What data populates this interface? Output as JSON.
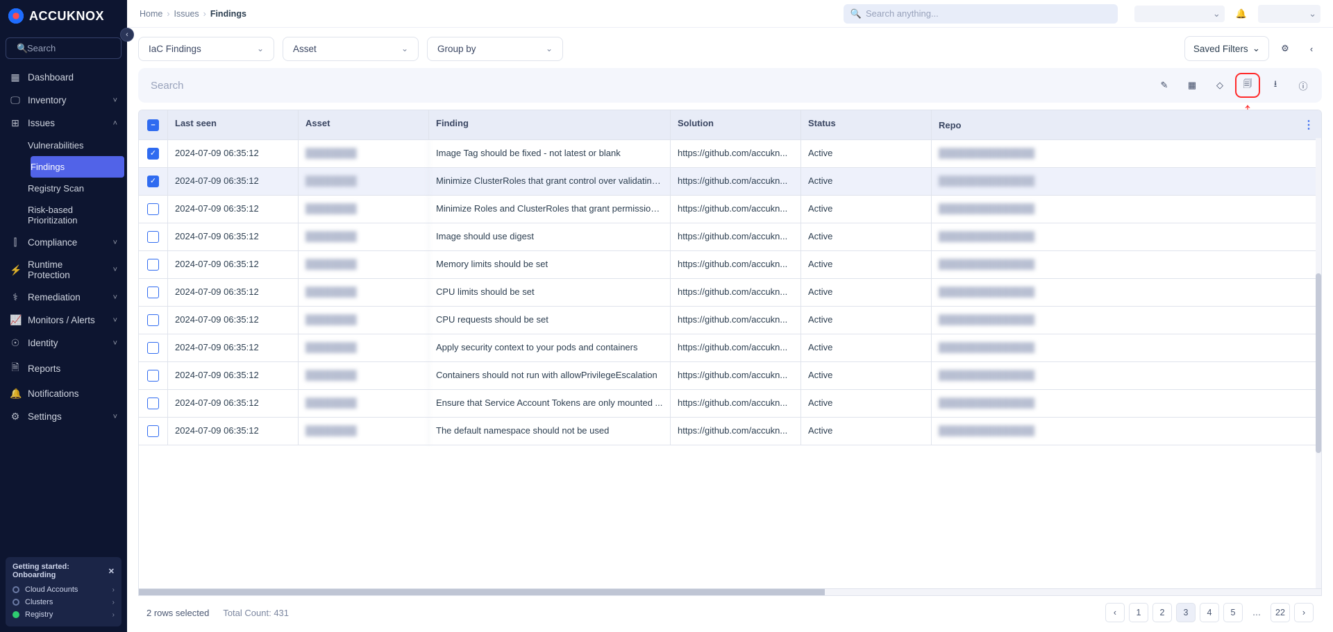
{
  "brand": {
    "name": "ACCUKNOX"
  },
  "sidebar": {
    "search_placeholder": "Search",
    "items": [
      {
        "label": "Dashboard",
        "icon": "▦",
        "expandable": false
      },
      {
        "label": "Inventory",
        "icon": "🖵",
        "expandable": true
      },
      {
        "label": "Issues",
        "icon": "⊞",
        "expandable": true,
        "expanded": true,
        "children": [
          {
            "label": "Vulnerabilities"
          },
          {
            "label": "Findings",
            "active": true
          },
          {
            "label": "Registry Scan"
          },
          {
            "label": "Risk-based Prioritization"
          }
        ]
      },
      {
        "label": "Compliance",
        "icon": "⫿",
        "expandable": true
      },
      {
        "label": "Runtime Protection",
        "icon": "⚡",
        "expandable": true
      },
      {
        "label": "Remediation",
        "icon": "⚕",
        "expandable": true
      },
      {
        "label": "Monitors / Alerts",
        "icon": "📈",
        "expandable": true
      },
      {
        "label": "Identity",
        "icon": "☉",
        "expandable": true
      },
      {
        "label": "Reports",
        "icon": "🗎",
        "expandable": false
      },
      {
        "label": "Notifications",
        "icon": "🔔",
        "expandable": false
      },
      {
        "label": "Settings",
        "icon": "⚙",
        "expandable": true
      }
    ],
    "onboarding": {
      "title": "Getting started: Onboarding",
      "items": [
        {
          "label": "Cloud Accounts",
          "done": false
        },
        {
          "label": "Clusters",
          "done": false
        },
        {
          "label": "Registry",
          "done": true
        }
      ]
    }
  },
  "breadcrumbs": [
    "Home",
    "Issues",
    "Findings"
  ],
  "global_search_placeholder": "Search anything...",
  "filters": {
    "type": "IaC Findings",
    "asset": "Asset",
    "groupby": "Group by",
    "saved": "Saved Filters"
  },
  "table_search_placeholder": "Search",
  "columns": [
    "",
    "Last seen",
    "Asset",
    "Finding",
    "Solution",
    "Status",
    "Repo"
  ],
  "rows": [
    {
      "checked": true,
      "last_seen": "2024-07-09 06:35:12",
      "finding": "Image Tag should be fixed - not latest or blank",
      "solution": "https://github.com/accukn...",
      "status": "Active"
    },
    {
      "checked": true,
      "last_seen": "2024-07-09 06:35:12",
      "finding": "Minimize ClusterRoles that grant control over validating...",
      "solution": "https://github.com/accukn...",
      "status": "Active",
      "hover": true
    },
    {
      "checked": false,
      "last_seen": "2024-07-09 06:35:12",
      "finding": "Minimize Roles and ClusterRoles that grant permissions...",
      "solution": "https://github.com/accukn...",
      "status": "Active"
    },
    {
      "checked": false,
      "last_seen": "2024-07-09 06:35:12",
      "finding": "Image should use digest",
      "solution": "https://github.com/accukn...",
      "status": "Active"
    },
    {
      "checked": false,
      "last_seen": "2024-07-09 06:35:12",
      "finding": "Memory limits should be set",
      "solution": "https://github.com/accukn...",
      "status": "Active"
    },
    {
      "checked": false,
      "last_seen": "2024-07-09 06:35:12",
      "finding": "CPU limits should be set",
      "solution": "https://github.com/accukn...",
      "status": "Active"
    },
    {
      "checked": false,
      "last_seen": "2024-07-09 06:35:12",
      "finding": "CPU requests should be set",
      "solution": "https://github.com/accukn...",
      "status": "Active"
    },
    {
      "checked": false,
      "last_seen": "2024-07-09 06:35:12",
      "finding": "Apply security context to your pods and containers",
      "solution": "https://github.com/accukn...",
      "status": "Active"
    },
    {
      "checked": false,
      "last_seen": "2024-07-09 06:35:12",
      "finding": "Containers should not run with allowPrivilegeEscalation",
      "solution": "https://github.com/accukn...",
      "status": "Active"
    },
    {
      "checked": false,
      "last_seen": "2024-07-09 06:35:12",
      "finding": "Ensure that Service Account Tokens are only mounted ...",
      "solution": "https://github.com/accukn...",
      "status": "Active"
    },
    {
      "checked": false,
      "last_seen": "2024-07-09 06:35:12",
      "finding": "The default namespace should not be used",
      "solution": "https://github.com/accukn...",
      "status": "Active"
    }
  ],
  "footer": {
    "selection": "2 rows selected",
    "total": "Total Count: 431",
    "pages": [
      "1",
      "2",
      "3",
      "4",
      "5",
      "...",
      "22"
    ],
    "active_page": "3"
  }
}
